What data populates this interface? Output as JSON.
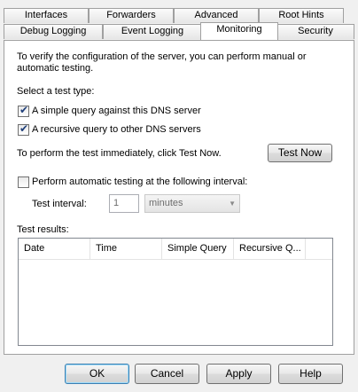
{
  "tabs_row1": [
    "Interfaces",
    "Forwarders",
    "Advanced",
    "Root Hints"
  ],
  "tabs_row2": [
    "Debug Logging",
    "Event Logging",
    "Monitoring",
    "Security"
  ],
  "intro_text_line1": "To verify the configuration of the server, you can perform manual or",
  "intro_text_line2": "automatic testing.",
  "select_test_type_label": "Select a test type:",
  "simple_query": {
    "label": "A simple query against this DNS server",
    "checked": true
  },
  "recursive_query": {
    "label": "A recursive query to other DNS servers",
    "checked": true
  },
  "immediate_text": "To perform the test immediately, click Test Now.",
  "test_now_label": "Test Now",
  "automatic_testing": {
    "label": "Perform automatic testing at the following interval:",
    "checked": false
  },
  "test_interval_label": "Test interval:",
  "test_interval_value": "1",
  "interval_unit": "minutes",
  "test_results_label": "Test results:",
  "results_columns": [
    "Date",
    "Time",
    "Simple Query",
    "Recursive Q..."
  ],
  "buttons": {
    "ok": "OK",
    "cancel": "Cancel",
    "apply": "Apply",
    "help": "Help"
  },
  "icons": {
    "check": "✔",
    "dropdown": "▼"
  }
}
